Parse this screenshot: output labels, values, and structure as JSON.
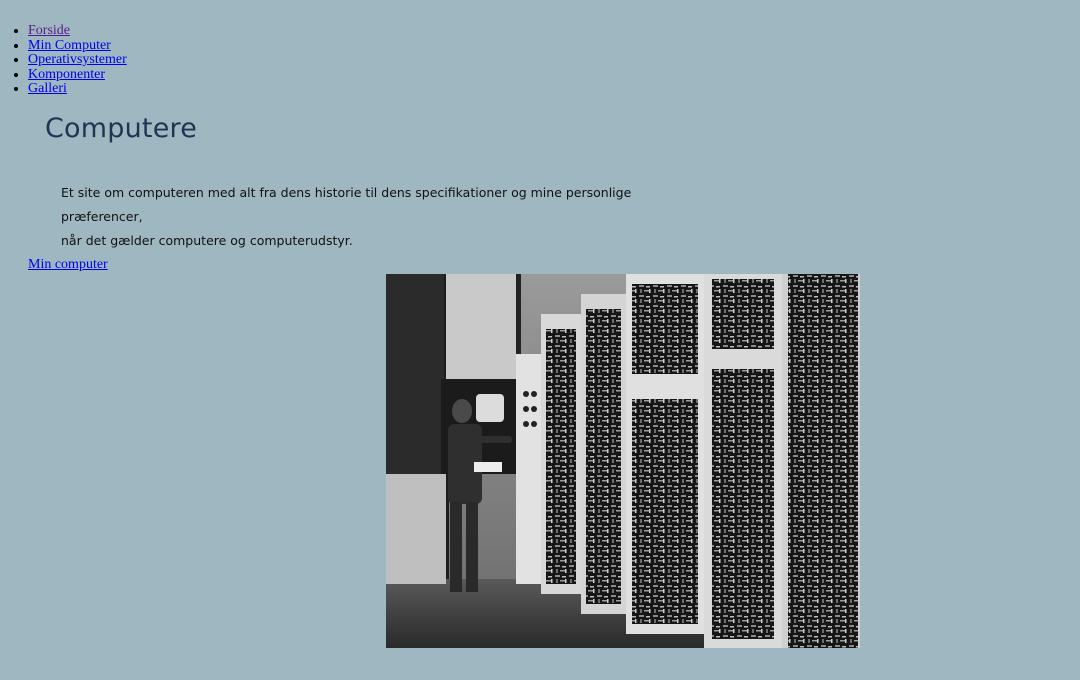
{
  "nav": {
    "items": [
      {
        "label": "Forside",
        "visited": true
      },
      {
        "label": "Min Computer",
        "visited": false
      },
      {
        "label": "Operativsystemer",
        "visited": false
      },
      {
        "label": "Komponenter",
        "visited": false
      },
      {
        "label": "Galleri",
        "visited": false
      }
    ]
  },
  "main": {
    "title": "Computere",
    "intro_line1": "Et site om computeren med alt fra dens historie til dens specifikationer og mine personlige præferencer,",
    "intro_line2": "når det gælder computere og computerudstyr.",
    "link_label": "Min computer"
  },
  "colors": {
    "background": "#9eb7c1",
    "title": "#1f3653",
    "link": "#0000ee",
    "visited_link": "#551a8b"
  }
}
